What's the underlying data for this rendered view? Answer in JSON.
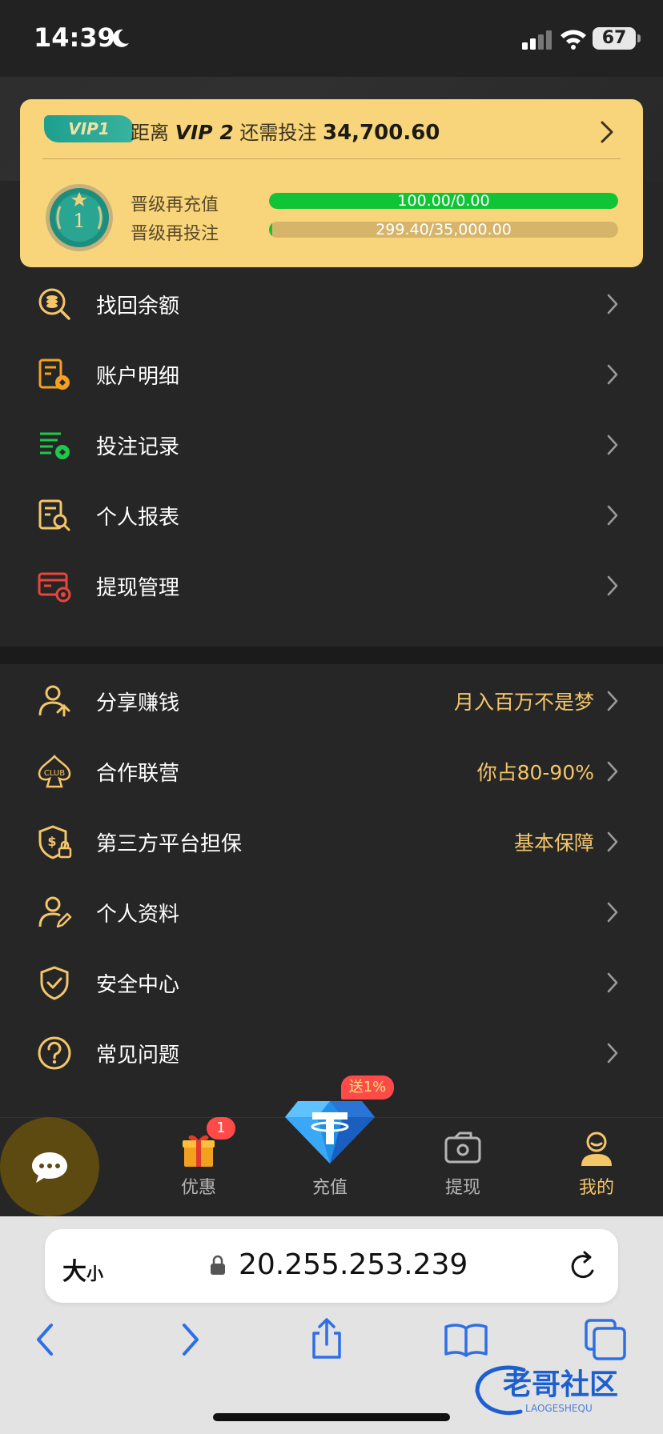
{
  "status_bar": {
    "time": "14:39",
    "battery": "67"
  },
  "vip_card": {
    "badge": "VIP1",
    "distance_prefix": "距离",
    "next_level": "VIP 2",
    "distance_middle": "还需投注",
    "remaining_amount": "34,700.60",
    "medal_level": "1",
    "recharge": {
      "label": "晋级再充值",
      "text": "100.00/0.00",
      "progress": 1.0
    },
    "betting": {
      "label": "晋级再投注",
      "text": "299.40/35,000.00",
      "progress": 0.0086
    },
    "colors": {
      "card": "#f8d57a",
      "progress": "#10c436"
    }
  },
  "menu_primary": [
    {
      "label": "找回余额",
      "icon": "coin-search-icon"
    },
    {
      "label": "账户明细",
      "icon": "account-detail-icon"
    },
    {
      "label": "投注记录",
      "icon": "bet-record-icon"
    },
    {
      "label": "个人报表",
      "icon": "report-icon"
    },
    {
      "label": "提现管理",
      "icon": "withdraw-card-icon"
    }
  ],
  "menu_secondary": [
    {
      "label": "分享赚钱",
      "extra": "月入百万不是梦",
      "icon": "share-user-icon"
    },
    {
      "label": "合作联营",
      "extra": "你占80-90%",
      "icon": "club-icon"
    },
    {
      "label": "第三方平台担保",
      "extra": "基本保障",
      "icon": "guarantee-shield-icon"
    },
    {
      "label": "个人资料",
      "extra": "",
      "icon": "profile-edit-icon"
    },
    {
      "label": "安全中心",
      "extra": "",
      "icon": "security-shield-icon"
    },
    {
      "label": "常见问题",
      "extra": "",
      "icon": "question-icon"
    }
  ],
  "tab_bar": {
    "promo": {
      "label": "优惠",
      "badge": "1"
    },
    "deposit": {
      "label": "充值",
      "tag": "送1%"
    },
    "withdraw": {
      "label": "提现"
    },
    "mine": {
      "label": "我的"
    }
  },
  "browser": {
    "text_size_big": "大",
    "text_size_small": "小",
    "url": "20.255.253.239"
  },
  "watermark": {
    "text": "老哥社区",
    "subtext": "LAOGESHEQU"
  }
}
